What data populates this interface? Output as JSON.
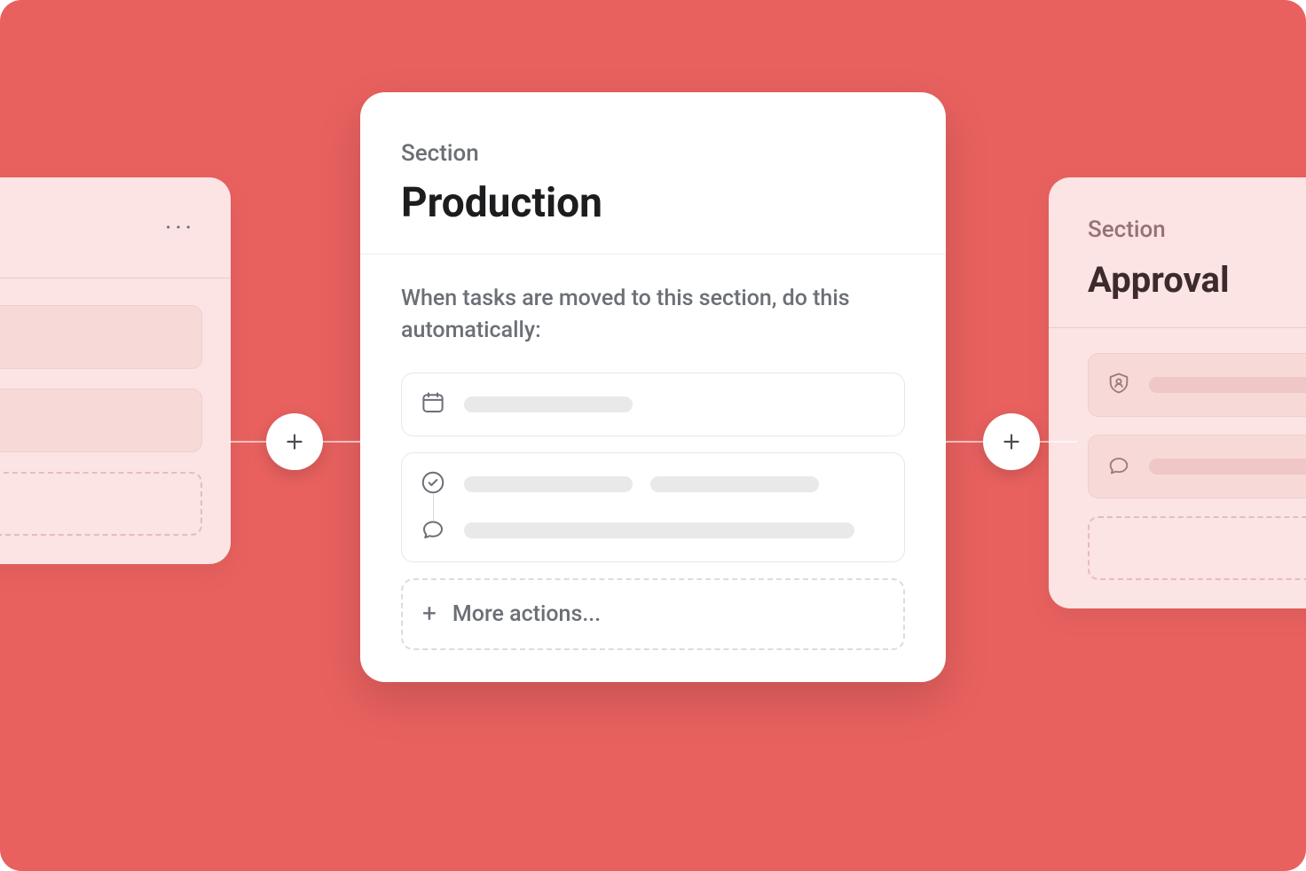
{
  "left_card": {
    "menu_glyph": "···"
  },
  "main_card": {
    "section_label": "Section",
    "title": "Production",
    "description": "When tasks are moved to this section, do this automatically:",
    "more_actions_label": "More actions..."
  },
  "right_card": {
    "section_label": "Section",
    "title": "Approval"
  }
}
